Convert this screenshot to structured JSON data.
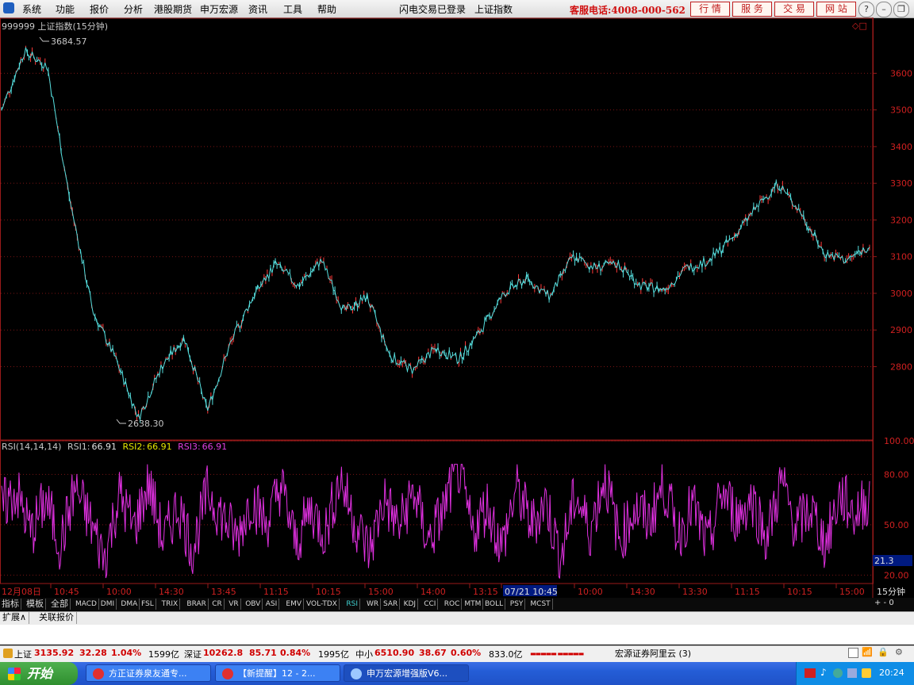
{
  "menu": {
    "items": [
      "系统",
      "功能",
      "报价",
      "分析",
      "港股期货",
      "申万宏源",
      "资讯",
      "工具",
      "帮助"
    ],
    "status": "闪电交易已登录",
    "index_name": "上证指数",
    "service_phone": "客服电话:4008-000-562",
    "buttons": [
      "行 情",
      "服 务",
      "交 易",
      "网 站"
    ],
    "window_controls": [
      "?",
      "–",
      "❐",
      "✕"
    ]
  },
  "price_chart": {
    "title": "999999 上证指数(15分钟)",
    "high_label": "3684.57",
    "low_label": "2638.30",
    "y_ticks": [
      "3600",
      "3500",
      "3400",
      "3300",
      "3200",
      "3100",
      "3000",
      "2900",
      "2800"
    ]
  },
  "rsi": {
    "name": "RSI(14,14,14)",
    "rsi1_label": "RSI1:",
    "rsi1": "66.91",
    "rsi2_label": "RSI2:",
    "rsi2": "66.91",
    "rsi3_label": "RSI3:",
    "rsi3": "66.91",
    "y_ticks": [
      "100.00",
      "80.00",
      "50.00",
      "20.00"
    ],
    "cursor_value": "21.3"
  },
  "time_axis": {
    "labels": [
      "12月08日",
      "10:45",
      "10:00",
      "14:30",
      "13:45",
      "11:15",
      "10:15",
      "15:00",
      "14:00",
      "13:15",
      "07/21 10:45",
      "10:00",
      "14:30",
      "13:30",
      "11:15",
      "10:15",
      "15:00"
    ],
    "period": "15分钟"
  },
  "tabs": [
    "指标",
    "模板",
    "全部",
    "MACD",
    "DMI",
    "DMA",
    "FSL",
    "TRIX",
    "BRAR",
    "CR",
    "VR",
    "OBV",
    "ASI",
    "EMV",
    "VOL-TDX",
    "RSI",
    "WR",
    "SAR",
    "KDJ",
    "CCI",
    "ROC",
    "MTM",
    "BOLL",
    "PSY",
    "MCST"
  ],
  "tabs_active": "RSI",
  "tabs_ctrl": "+  -  0",
  "expand_bar": [
    "扩展∧",
    "关联报价"
  ],
  "status": {
    "sh_name": "上证",
    "sh_value": "3135.92",
    "sh_change": "32.28",
    "sh_pct": "1.04%",
    "sh_amount": "1599亿",
    "sz_name": "深证",
    "sz_value": "10262.8",
    "sz_change": "85.71",
    "sz_pct": "0.84%",
    "sz_amount": "1995亿",
    "zx_name": "中小",
    "zx_value": "6510.90",
    "zx_change": "38.67",
    "zx_pct": "0.60%",
    "zx_amount": "833.0亿",
    "broker": "宏源证券阿里云 (3)"
  },
  "taskbar": {
    "start": "开始",
    "tasks": [
      "方正证券泉友通专...",
      "【新提醒】12 - 2...",
      "申万宏源增强版V6..."
    ],
    "clock": "20:24"
  },
  "chart_data": {
    "type": "line",
    "title": "999999 上证指数(15分钟)",
    "ylim": [
      2600,
      3750
    ],
    "x": [
      "12月08日",
      "10:45",
      "10:00",
      "14:30",
      "13:45",
      "11:15",
      "10:15",
      "15:00",
      "14:00",
      "13:15",
      "07/21 10:45",
      "10:00",
      "14:30",
      "13:30",
      "11:15",
      "10:15",
      "15:00"
    ],
    "series": [
      {
        "name": "",
        "values": [
          3500,
          3660,
          3620,
          3250,
          2950,
          2820,
          2660,
          2800,
          2880,
          2680,
          2860,
          2990,
          3080,
          3020,
          3090,
          2950,
          2990,
          2830,
          2790,
          2850,
          2820,
          2900,
          3000,
          3040,
          2990,
          3100,
          3070,
          3080,
          3020,
          3010,
          3070,
          3090,
          3150,
          3230,
          3300,
          3220,
          3110,
          3090,
          3130
        ]
      }
    ],
    "highlights": {
      "max": 3684.57,
      "min": 2638.3
    },
    "grid": true,
    "sub_chart": {
      "type": "line",
      "name": "RSI(14,14,14)",
      "ylim": [
        15,
        100
      ],
      "y_ticks": [
        100,
        80,
        50,
        20
      ],
      "series": [
        {
          "name": "RSI1",
          "values": [
            60,
            70,
            45,
            65,
            38,
            72,
            52,
            30,
            68,
            48,
            75,
            40,
            62,
            35,
            70,
            55,
            42,
            66,
            50,
            74,
            38,
            60,
            45,
            78,
            52,
            34,
            66,
            48,
            70,
            40,
            58,
            85,
            45,
            62,
            36,
            72,
            50,
            64,
            30,
            68,
            46,
            80,
            40,
            60,
            52,
            74,
            44,
            62,
            36,
            70,
            54,
            66,
            42,
            76,
            48,
            60,
            38,
            68,
            56,
            66.91
          ]
        }
      ]
    }
  }
}
